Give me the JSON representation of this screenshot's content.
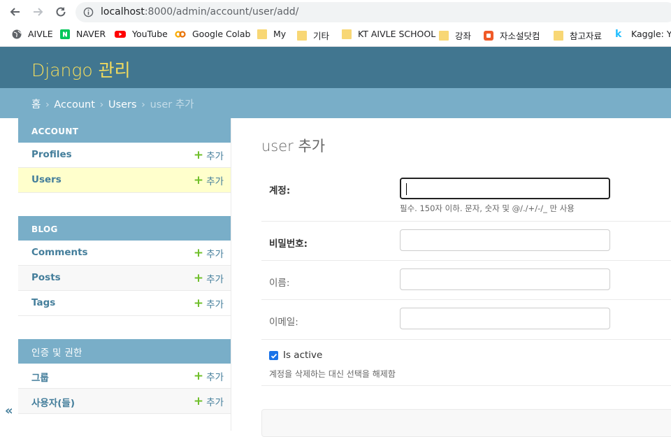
{
  "browser": {
    "url_host": "localhost",
    "url_path": ":8000/admin/account/user/add/",
    "bookmarks": [
      {
        "label": "AIVLE",
        "icon": "globe-icon"
      },
      {
        "label": "NAVER",
        "icon": "naver-icon"
      },
      {
        "label": "YouTube",
        "icon": "youtube-icon"
      },
      {
        "label": "Google Colab",
        "icon": "colab-icon"
      },
      {
        "label": "My",
        "icon": "folder-icon"
      },
      {
        "label": "기타",
        "icon": "folder-icon"
      },
      {
        "label": "KT AIVLE SCHOOL",
        "icon": "folder-icon"
      },
      {
        "label": "강좌",
        "icon": "folder-icon"
      },
      {
        "label": "자소설닷컴",
        "icon": "jasoseol-icon"
      },
      {
        "label": "참고자료",
        "icon": "folder-icon"
      },
      {
        "label": "Kaggle: Yo",
        "icon": "kaggle-icon"
      }
    ]
  },
  "header": {
    "brand": "Django 관리"
  },
  "breadcrumbs": {
    "home": "홈",
    "app": "Account",
    "model": "Users",
    "current": "user 추가"
  },
  "sidebar": {
    "modules": [
      {
        "caption": "ACCOUNT",
        "models": [
          {
            "name": "Profiles",
            "add": "추가"
          },
          {
            "name": "Users",
            "add": "추가"
          }
        ]
      },
      {
        "caption": "BLOG",
        "models": [
          {
            "name": "Comments",
            "add": "추가"
          },
          {
            "name": "Posts",
            "add": "추가"
          },
          {
            "name": "Tags",
            "add": "추가"
          }
        ]
      },
      {
        "caption": "인증 및 권한",
        "models": [
          {
            "name": "그룹",
            "add": "추가"
          },
          {
            "name": "사용자(들)",
            "add": "추가"
          }
        ]
      }
    ],
    "collapse": "«"
  },
  "form": {
    "title": "user 추가",
    "username": {
      "label": "계정:",
      "value": "",
      "help": "필수. 150자 이하. 문자, 숫자 및 @/./+/-/_ 만 사용"
    },
    "password": {
      "label": "비밀번호:",
      "value": ""
    },
    "name": {
      "label": "이름:",
      "value": ""
    },
    "email": {
      "label": "이메일:",
      "value": ""
    },
    "is_active": {
      "label": "Is active",
      "checked": true,
      "help": "계정을 삭제하는 대신 선택을 해제함"
    }
  },
  "colors": {
    "header": "#417690",
    "brand": "#f5dd5d",
    "breadcrumbs": "#79aec8",
    "link": "#447e9b",
    "add_plus": "#70bf2b",
    "current_row": "#ffffcc"
  }
}
